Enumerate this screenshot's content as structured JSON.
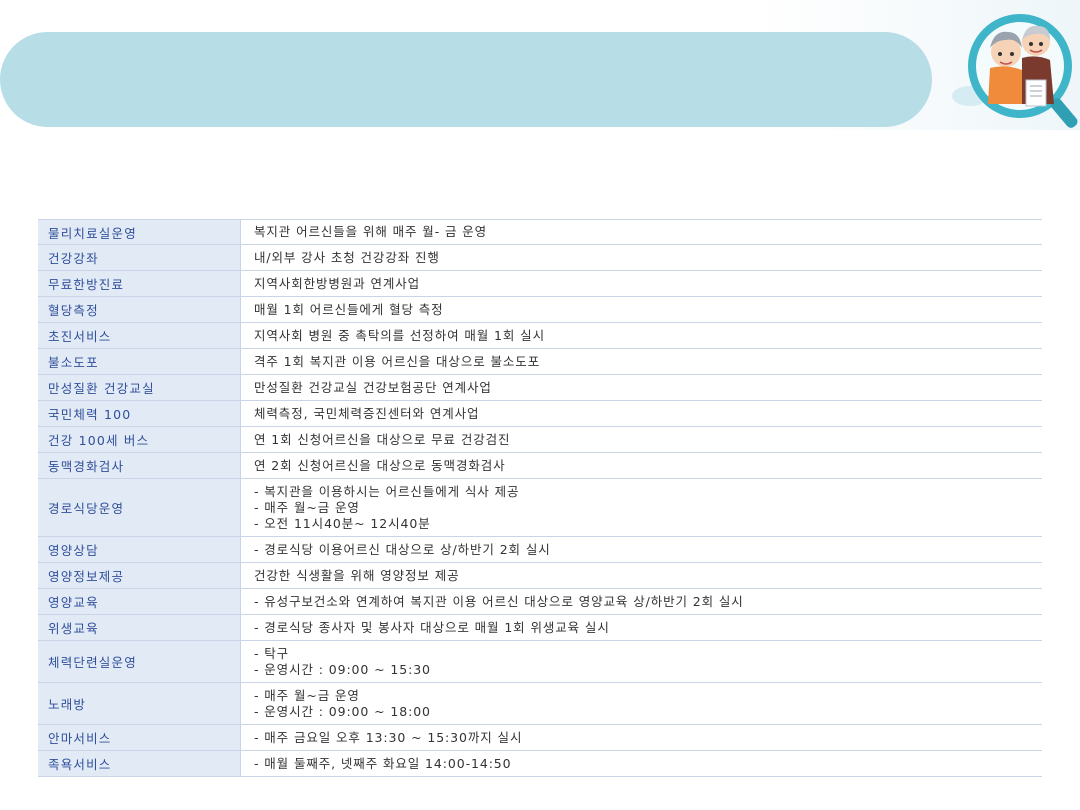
{
  "rows": [
    {
      "label": "물리치료실운영",
      "lines": [
        "복지관 어르신들을 위해 매주 월- 금 운영"
      ],
      "h": 26
    },
    {
      "label": "건강강좌",
      "lines": [
        "내/외부 강사 초청 건강강좌 진행"
      ],
      "h": 26
    },
    {
      "label": "무료한방진료",
      "lines": [
        "지역사회한방병원과 연계사업"
      ],
      "h": 26
    },
    {
      "label": "혈당측정",
      "lines": [
        "매월 1회 어르신들에게 혈당 측정"
      ],
      "h": 26
    },
    {
      "label": "초진서비스",
      "lines": [
        "지역사회 병원 중 촉탁의를 선정하여 매월 1회 실시"
      ],
      "h": 26
    },
    {
      "label": "불소도포",
      "lines": [
        "격주 1회 복지관 이용 어르신을 대상으로 불소도포"
      ],
      "h": 26
    },
    {
      "label": "만성질환 건강교실",
      "lines": [
        "만성질환 건강교실 건강보험공단 연계사업"
      ],
      "h": 26
    },
    {
      "label": "국민체력 100",
      "lines": [
        "체력측정, 국민체력증진센터와 연계사업"
      ],
      "h": 26
    },
    {
      "label": "건강 100세 버스",
      "lines": [
        "연 1회 신청어르신을 대상으로 무료 건강검진"
      ],
      "h": 26
    },
    {
      "label": "동맥경화검사",
      "lines": [
        "연 2회 신청어르신을 대상으로 동맥경화검사"
      ],
      "h": 26
    },
    {
      "label": "경로식당운영",
      "lines": [
        "- 복지관을 이용하시는 어르신들에게 식사 제공",
        "- 매주 월~금 운영",
        "- 오전 11시40분~ 12시40분"
      ],
      "h": 58
    },
    {
      "label": "영양상담",
      "lines": [
        "- 경로식당 이용어르신 대상으로 상/하반기 2회 실시"
      ],
      "h": 26
    },
    {
      "label": "영양정보제공",
      "lines": [
        "건강한 식생활을 위해 영양정보 제공"
      ],
      "h": 26
    },
    {
      "label": "영양교육",
      "lines": [
        "- 유성구보건소와 연계하여 복지관 이용 어르신 대상으로 영양교육 상/하반기 2회 실시"
      ],
      "h": 26
    },
    {
      "label": "위생교육",
      "lines": [
        "- 경로식당 종사자 및 봉사자 대상으로 매월 1회 위생교육 실시"
      ],
      "h": 26
    },
    {
      "label": "체력단련실운영",
      "lines": [
        "- 탁구",
        "- 운영시간 : 09:00 ~ 15:30"
      ],
      "h": 42
    },
    {
      "label": "노래방",
      "lines": [
        "- 매주 월~금 운영",
        "- 운영시간 : 09:00 ~ 18:00"
      ],
      "h": 42
    },
    {
      "label": "안마서비스",
      "lines": [
        "- 매주 금요일 오후 13:30 ~ 15:30까지 실시"
      ],
      "h": 26
    },
    {
      "label": "족욕서비스",
      "lines": [
        "- 매월 둘째주, 넷째주 화요일 14:00-14:50"
      ],
      "h": 26
    }
  ],
  "colors": {
    "header_pill": "#b7dde7",
    "label_bg": "#e2eaf6",
    "label_text": "#2f4f9a",
    "border": "#c9d5e6",
    "magnifier": "#3fb5c9"
  }
}
